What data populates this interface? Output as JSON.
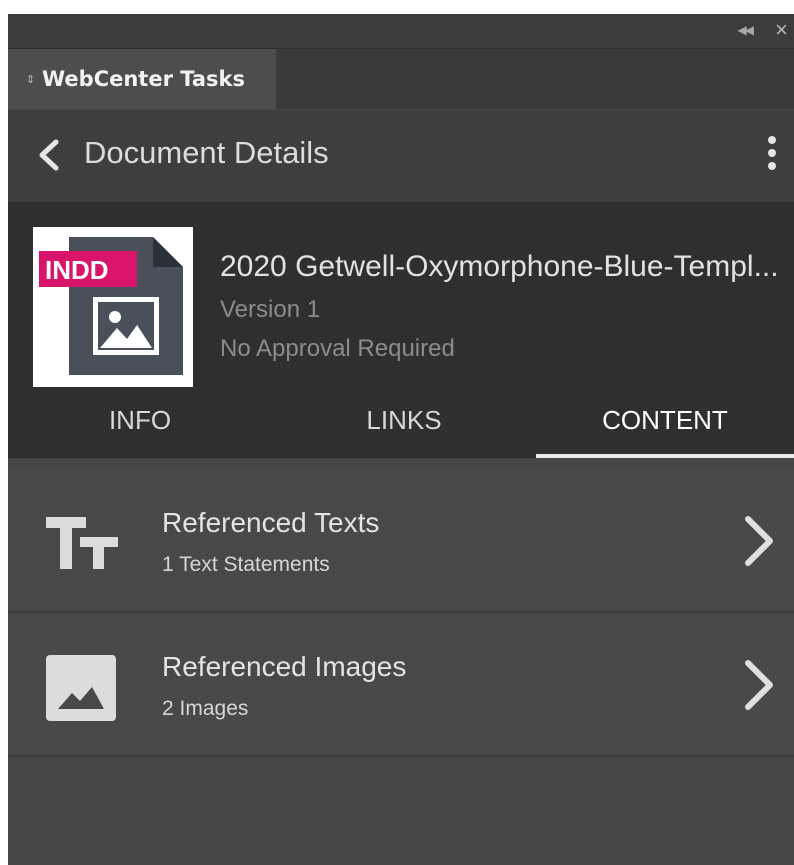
{
  "panel": {
    "tab_label": "WebCenter Tasks",
    "collapse_icon": "double-chevron-left-icon",
    "close_icon": "close-icon"
  },
  "header": {
    "title": "Document Details",
    "back_icon": "chevron-left-icon",
    "menu_icon": "kebab-menu-icon"
  },
  "document": {
    "badge": "INDD",
    "badge_color": "#d8156b",
    "name": "2020 Getwell-Oxymorphone-Blue-Templ...",
    "version": "Version 1",
    "approval": "No Approval Required"
  },
  "tabs": [
    {
      "label": "INFO",
      "active": false
    },
    {
      "label": "LINKS",
      "active": false
    },
    {
      "label": "CONTENT",
      "active": true
    }
  ],
  "content_items": [
    {
      "title": "Referenced Texts",
      "subtitle": "1 Text Statements",
      "icon": "text-type-icon"
    },
    {
      "title": "Referenced Images",
      "subtitle": "2 Images",
      "icon": "image-icon"
    }
  ]
}
